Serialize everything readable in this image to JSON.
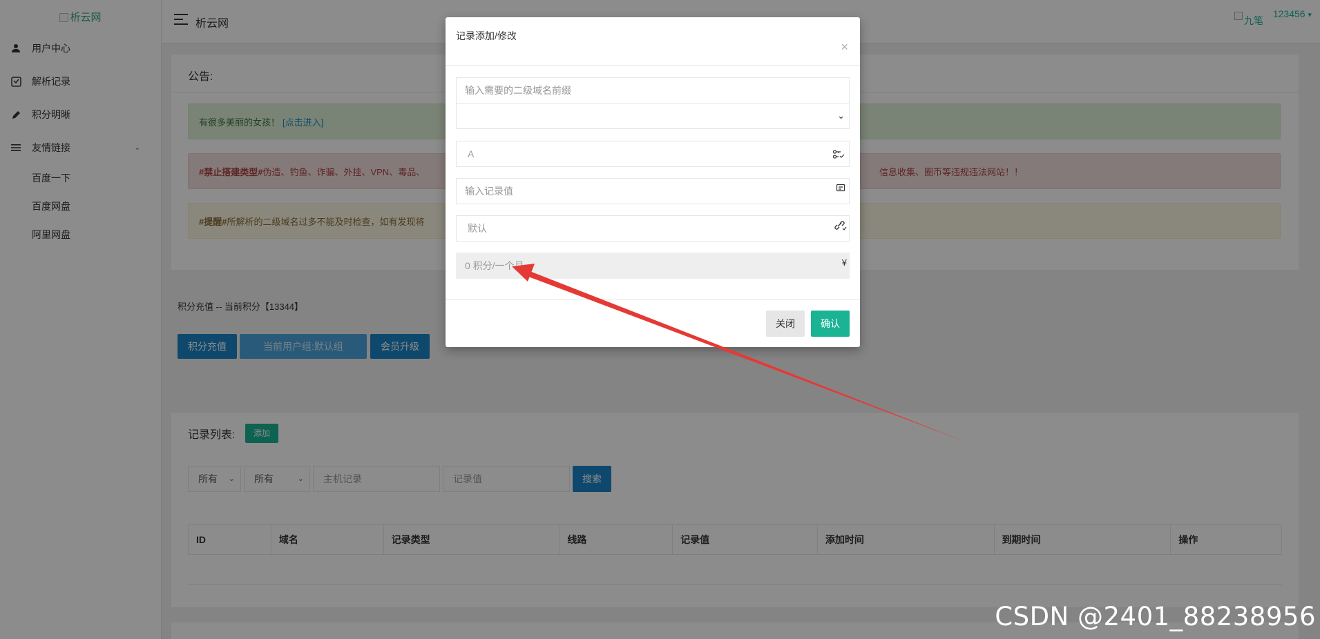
{
  "app": {
    "logo_alt": "析云网",
    "site_name": "析云网",
    "user_avatar_alt": "九笔",
    "username": "123456",
    "dropdown_caret": "▾"
  },
  "sidebar": {
    "items": [
      {
        "label": "用户中心",
        "icon": "user-icon"
      },
      {
        "label": "解析记录",
        "icon": "record-icon"
      },
      {
        "label": "积分明晰",
        "icon": "pencil-icon"
      },
      {
        "label": "友情链接",
        "icon": "list-icon"
      }
    ],
    "sub_items": [
      "百度一下",
      "百度网盘",
      "阿里网盘"
    ]
  },
  "notice": {
    "title": "公告:",
    "success_text": "有很多美丽的女孩！",
    "success_link": "[点击进入]",
    "danger_tag": "#禁止搭建类型#",
    "danger_text": " 伪造、钓鱼、诈骗、外挂、VPN、毒品、",
    "danger_tail": "信息收集、圈币等违规违法网站！！",
    "warning_tag": "#提醒#",
    "warning_text": " 所解析的二级域名过多不能及时检查，如有发现将"
  },
  "points": {
    "title": "积分充值 -- 当前积分【13344】",
    "recharge_button": "积分充值",
    "group_button": "当前用户组:默认组",
    "upgrade_button": "会员升级"
  },
  "records": {
    "title": "记录列表:",
    "add_button": "添加",
    "filter_1": "所有",
    "filter_2": "所有",
    "host_placeholder": "主机记录",
    "value_placeholder": "记录值",
    "search_button": "搜索",
    "columns": [
      "ID",
      "域名",
      "记录类型",
      "线路",
      "记录值",
      "添加时间",
      "到期时间",
      "操作"
    ]
  },
  "modal": {
    "title": "记录添加/修改",
    "close_symbol": "×",
    "subdomain_placeholder": "输入需要的二级域名前缀",
    "record_type": "A",
    "record_value_placeholder": "输入记录值",
    "line": "默认",
    "cost": "0 积分/一个月",
    "currency_symbol": "¥",
    "close_button": "关闭",
    "confirm_button": "确认"
  },
  "watermark": "CSDN @2401_88238956",
  "colors": {
    "accent_green": "#1ab394",
    "accent_blue": "#1c84c6",
    "arrow_red": "#e53935"
  }
}
